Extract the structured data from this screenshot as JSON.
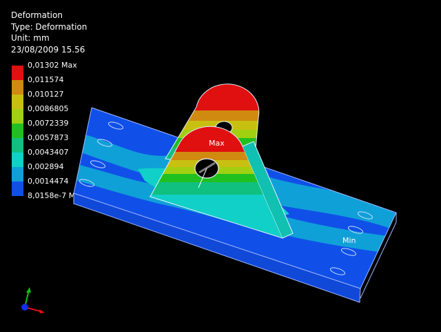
{
  "result_info": {
    "title": "Deformation",
    "type_line": "Type: Deformation",
    "unit_line": "Unit: mm",
    "timestamp": "23/08/2009 15.56"
  },
  "legend": {
    "labels": [
      "0,01302 Max",
      "0,011574",
      "0,010127",
      "0,0086805",
      "0,0072339",
      "0,0057873",
      "0,0043407",
      "0,002894",
      "0,0014474",
      "8,0158e-7 Min"
    ],
    "colors": [
      "#e01010",
      "#d08a10",
      "#c8c010",
      "#a0d010",
      "#20c020",
      "#10c080",
      "#10d0c8",
      "#10a0d8",
      "#1050e8",
      "#0010e0"
    ]
  },
  "model": {
    "max_label": "Max",
    "min_label": "Min"
  },
  "triad": {
    "x_color": "#e01010",
    "y_color": "#10c010",
    "z_color": "#1030e0"
  }
}
